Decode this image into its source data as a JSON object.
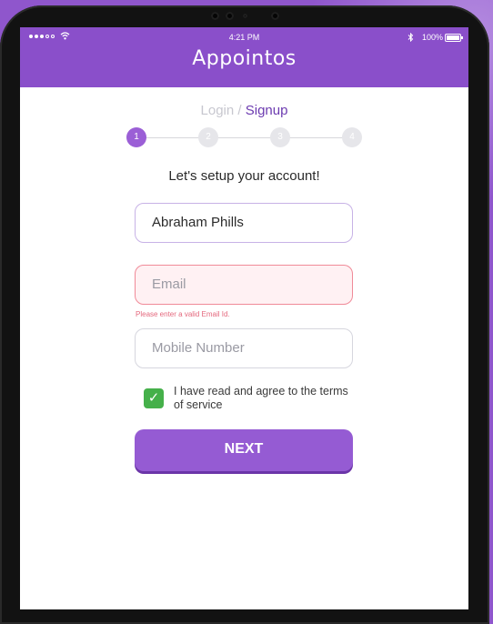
{
  "status_bar": {
    "time": "4:21 PM",
    "battery_text": "100%",
    "battery_level": 1.0,
    "signal_icon": "signal-dots-icon",
    "wifi_icon": "wifi-icon",
    "bluetooth_icon": "bluetooth-icon"
  },
  "header": {
    "brand": "Appointos",
    "color": "#8a4fca"
  },
  "tabs": {
    "login": "Login",
    "separator": "/",
    "signup": "Signup"
  },
  "stepper": {
    "steps": [
      "1",
      "2",
      "3",
      "4"
    ],
    "active_step": 1,
    "active_color": "#9b5fd6"
  },
  "form": {
    "title": "Let's setup your account!",
    "name_value": "Abraham Phills",
    "email_placeholder": "Email",
    "email_error": "Please enter a valid Email Id.",
    "mobile_placeholder": "Mobile Number",
    "terms_text": "I have read and agree to the terms of service",
    "terms_checked": true,
    "next_label": "NEXT"
  }
}
